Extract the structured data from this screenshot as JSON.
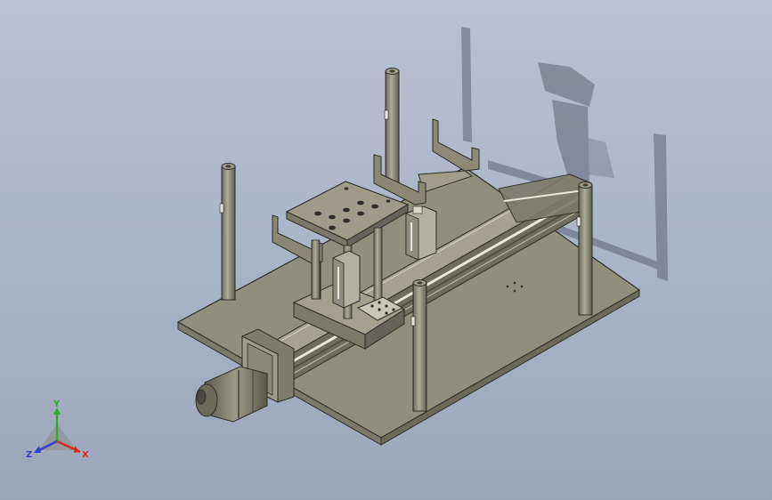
{
  "viewport": {
    "background_top": "#b9c2d3",
    "background_bottom": "#9da7bb"
  },
  "model": {
    "components": [
      "base-plate",
      "linear-actuator-rail",
      "servo-motor",
      "support-posts",
      "top-platform",
      "guide-brackets",
      "pneumatic-cylinders",
      "sheet-metal-shields"
    ],
    "colors": {
      "body": "#8f8d7b",
      "body_dark": "#6d6b5c",
      "body_light": "#a6a491",
      "edge": "#2e2d27",
      "shadow": "#4a4f5c",
      "rail_highlight": "#e8e8df"
    }
  },
  "triad": {
    "axes": [
      {
        "name": "X",
        "color": "#d42a1e"
      },
      {
        "name": "Y",
        "color": "#2cae2c"
      },
      {
        "name": "Z",
        "color": "#2f40d6"
      }
    ]
  }
}
